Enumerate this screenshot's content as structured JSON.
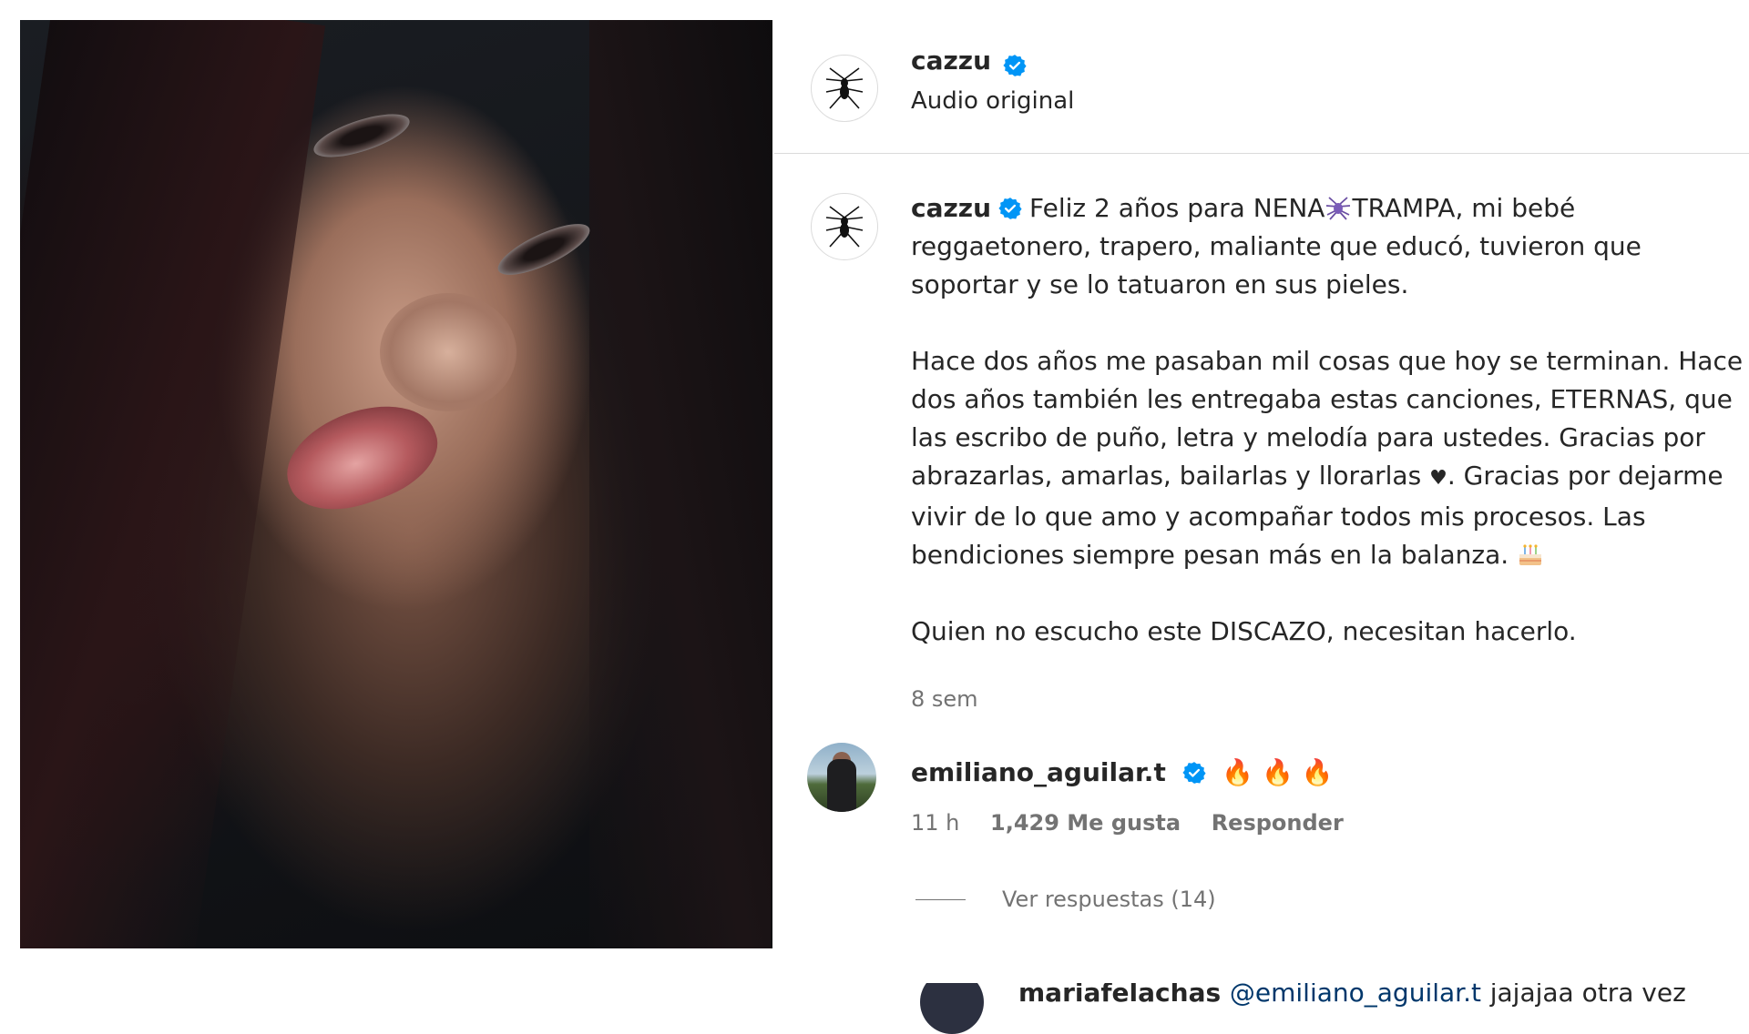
{
  "header": {
    "username": "cazzu",
    "audio_label": "Audio original"
  },
  "caption": {
    "author": "cazzu",
    "line1_a": "Feliz 2 años para NENA",
    "line1_b": "TRAMPA, mi bebé reggaetonero, trapero, maliante que educó, tuvieron que soportar y se lo tatuaron en sus pieles.",
    "para2_a": "Hace dos años me pasaban mil cosas que hoy se terminan. Hace dos años también les entregaba estas canciones, ETERNAS, que las escribo de puño, letra y melodía para ustedes. Gracias por abrazarlas, amarlas, bailarlas y llorarlas",
    "heart": "♥",
    "para2_b": ". Gracias por dejarme vivir de lo que amo y acompañar todos mis procesos. Las bendiciones siempre pesan más en la balanza.",
    "para3": "Quien no escucho este DISCAZO, necesitan hacerlo.",
    "time": "8 sem"
  },
  "comment": {
    "username": "emiliano_aguilar.t",
    "text": "🔥 🔥 🔥",
    "time": "11 h",
    "likes": "1,429 Me gusta",
    "reply_label": "Responder",
    "view_replies": "Ver respuestas (14)"
  },
  "reply_peek": {
    "username": "mariafelachas",
    "mention": "@emiliano_aguilar.t",
    "text": "jajajaa otra vez"
  },
  "colors": {
    "verified": "#0095f6",
    "fire": "#f27b22",
    "text": "#262626",
    "muted": "#737373"
  },
  "icons": [
    "verified-badge-icon",
    "spider-avatar-icon",
    "spider-emoji-icon",
    "cake-emoji-icon",
    "fire-emoji-icon"
  ]
}
